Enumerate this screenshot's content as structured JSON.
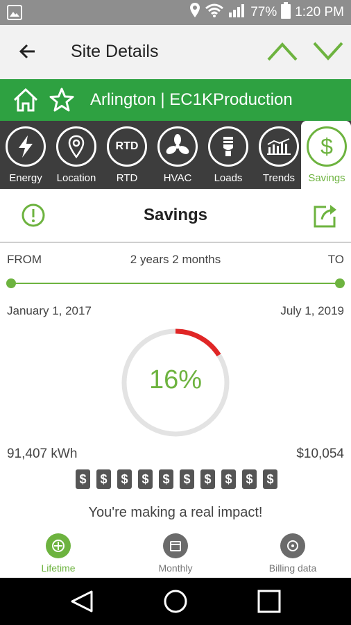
{
  "status_bar": {
    "battery": "77%",
    "time": "1:20 PM",
    "icons": [
      "image-icon",
      "location-icon",
      "wifi-icon",
      "signal-icon",
      "battery-icon"
    ]
  },
  "app_bar": {
    "title": "Site Details",
    "icons": [
      "back-arrow-icon",
      "chevron-up-icon",
      "chevron-down-icon"
    ]
  },
  "site": {
    "name": "Arlington | EC1KProduction",
    "icons": [
      "home-icon",
      "star-icon"
    ]
  },
  "nav": {
    "items": [
      {
        "label": "Energy",
        "icon": "bolt-icon"
      },
      {
        "label": "Location",
        "icon": "location-pin-icon"
      },
      {
        "label": "RTD",
        "icon": "rtd-icon",
        "icon_text": "RTD"
      },
      {
        "label": "HVAC",
        "icon": "fan-icon"
      },
      {
        "label": "Loads",
        "icon": "bulb-icon"
      },
      {
        "label": "Trends",
        "icon": "trends-icon"
      },
      {
        "label": "Savings",
        "icon": "dollar-icon",
        "icon_text": "$",
        "active": true
      }
    ]
  },
  "section": {
    "title": "Savings",
    "icons": [
      "alert-icon",
      "share-icon"
    ]
  },
  "range": {
    "from_label": "FROM",
    "to_label": "TO",
    "duration": "2 years 2 months",
    "start_date": "January 1, 2017",
    "end_date": "July 1, 2019"
  },
  "gauge": {
    "percent_text": "16%",
    "value": 0.16,
    "colors": {
      "fill": "#e02626",
      "track": "#e3e3e3",
      "text": "#6db33f"
    }
  },
  "stats": {
    "energy": "91,407 kWh",
    "money": "$10,054"
  },
  "dollar_meter": {
    "symbol": "$",
    "count": 10
  },
  "impact_text": "You're making a real impact!",
  "bottom_tabs": [
    {
      "label": "Lifetime",
      "active": true
    },
    {
      "label": "Monthly"
    },
    {
      "label": "Billing data"
    }
  ],
  "colors": {
    "brand_green": "#2ea141",
    "accent_green": "#6db33f",
    "nav_dark": "#3d3d3d",
    "status_gray": "#8e8e8e"
  }
}
